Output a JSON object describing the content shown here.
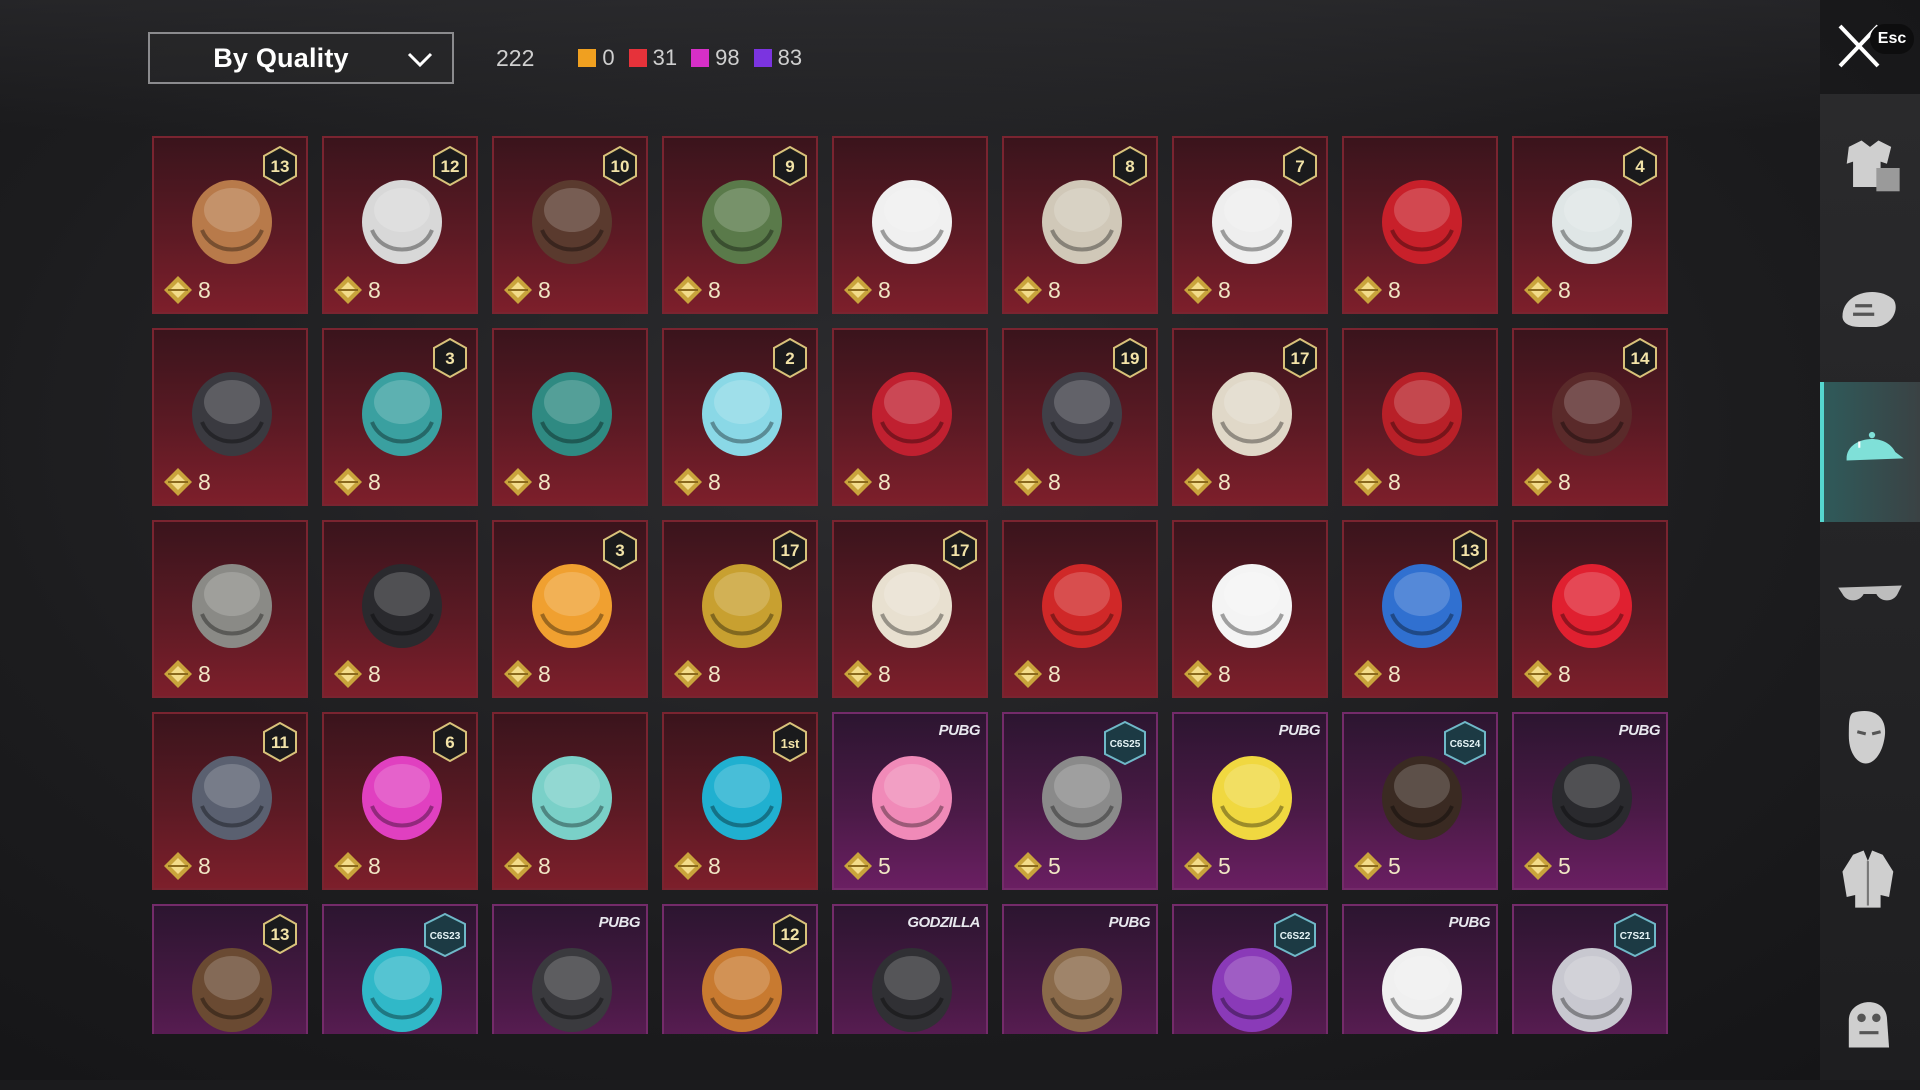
{
  "filter": {
    "label": "By Quality"
  },
  "total": "222",
  "quality_counts": [
    {
      "color": "#f0a020",
      "value": "0"
    },
    {
      "color": "#e6323a",
      "value": "31"
    },
    {
      "color": "#d62fc7",
      "value": "98"
    },
    {
      "color": "#7b34e0",
      "value": "83"
    }
  ],
  "close": {
    "esc_label": "Esc"
  },
  "sidebar": [
    {
      "icon": "outfit-icon"
    },
    {
      "icon": "mask-icon"
    },
    {
      "icon": "cap-icon",
      "active": true
    },
    {
      "icon": "glasses-icon"
    },
    {
      "icon": "face-icon"
    },
    {
      "icon": "jacket-icon"
    },
    {
      "icon": "emote-icon"
    }
  ],
  "items": [
    {
      "quality": "red",
      "badge": "13",
      "cost": "8",
      "icon": "feather-hat-wig-icon",
      "art": "#b87a4a"
    },
    {
      "quality": "red",
      "badge": "12",
      "cost": "8",
      "icon": "white-braided-wig-icon",
      "art": "#d8d8d8"
    },
    {
      "quality": "red",
      "badge": "10",
      "cost": "8",
      "icon": "brown-long-wig-icon",
      "art": "#5a3a2e"
    },
    {
      "quality": "red",
      "badge": "9",
      "cost": "8",
      "icon": "zombie-mask-icon",
      "art": "#5a7a4a"
    },
    {
      "quality": "red",
      "badge": "",
      "cost": "8",
      "icon": "white-cowboy-hat-icon",
      "art": "#f0f0f0"
    },
    {
      "quality": "red",
      "badge": "8",
      "cost": "8",
      "icon": "silver-winged-hair-icon",
      "art": "#d0c8b8"
    },
    {
      "quality": "red",
      "badge": "7",
      "cost": "8",
      "icon": "white-ponytail-hair-icon",
      "art": "#eeeeee"
    },
    {
      "quality": "red",
      "badge": "",
      "cost": "8",
      "icon": "red-helmet-icon",
      "art": "#c8202a"
    },
    {
      "quality": "red",
      "badge": "4",
      "cost": "8",
      "icon": "snowman-tophat-icon",
      "art": "#dfe6e6"
    },
    {
      "quality": "red",
      "badge": "",
      "cost": "8",
      "icon": "spider-helmet-icon",
      "art": "#3a3a40"
    },
    {
      "quality": "red",
      "badge": "3",
      "cost": "8",
      "icon": "joker-mask-icon",
      "art": "#3aa0a0"
    },
    {
      "quality": "red",
      "badge": "",
      "cost": "8",
      "icon": "teal-dragon-helm-icon",
      "art": "#2f8a82"
    },
    {
      "quality": "red",
      "badge": "2",
      "cost": "8",
      "icon": "ice-bucket-hat-icon",
      "art": "#8ad8e6"
    },
    {
      "quality": "red",
      "badge": "",
      "cost": "8",
      "icon": "red-oni-mask-icon",
      "art": "#c02030"
    },
    {
      "quality": "red",
      "badge": "19",
      "cost": "8",
      "icon": "dark-tactical-helmet-icon",
      "art": "#404048"
    },
    {
      "quality": "red",
      "badge": "17",
      "cost": "8",
      "icon": "white-spiky-hair-icon",
      "art": "#e0d8c8"
    },
    {
      "quality": "red",
      "badge": "",
      "cost": "8",
      "icon": "red-robot-helmet-icon",
      "art": "#b82028"
    },
    {
      "quality": "red",
      "badge": "14",
      "cost": "8",
      "icon": "golden-horn-hood-icon",
      "art": "#5a2a2a"
    },
    {
      "quality": "red",
      "badge": "",
      "cost": "8",
      "icon": "knight-helm-icon",
      "art": "#8a8a86"
    },
    {
      "quality": "red",
      "badge": "",
      "cost": "8",
      "icon": "black-bat-helm-icon",
      "art": "#2a2a2e"
    },
    {
      "quality": "red",
      "badge": "3",
      "cost": "8",
      "icon": "fries-hat-icon",
      "art": "#f0a030"
    },
    {
      "quality": "red",
      "badge": "17",
      "cost": "8",
      "icon": "gold-black-helmet-icon",
      "art": "#c8a030"
    },
    {
      "quality": "red",
      "badge": "17",
      "cost": "8",
      "icon": "white-gold-crown-icon",
      "art": "#e8e0d0"
    },
    {
      "quality": "red",
      "badge": "",
      "cost": "8",
      "icon": "panda-red-hair-icon",
      "art": "#d02828"
    },
    {
      "quality": "red",
      "badge": "",
      "cost": "8",
      "icon": "ghost-hood-icon",
      "art": "#f4f4f4"
    },
    {
      "quality": "red",
      "badge": "13",
      "cost": "8",
      "icon": "blue-mech-helmet-icon",
      "art": "#3070d0"
    },
    {
      "quality": "red",
      "badge": "",
      "cost": "8",
      "icon": "red-bow-clip-icon",
      "art": "#e02030"
    },
    {
      "quality": "red",
      "badge": "11",
      "cost": "8",
      "icon": "cyber-helmet-icon",
      "art": "#5a6070"
    },
    {
      "quality": "red",
      "badge": "6",
      "cost": "8",
      "icon": "pink-tv-head-icon",
      "art": "#e040c0"
    },
    {
      "quality": "red",
      "badge": "",
      "cost": "8",
      "icon": "butterfly-flower-icon",
      "art": "#7ad0c8"
    },
    {
      "quality": "red",
      "badge": "1st",
      "cost": "8",
      "icon": "neon-racer-helmet-icon",
      "art": "#20b0d0"
    },
    {
      "quality": "purple",
      "tag": "PUBG",
      "cost": "5",
      "icon": "pink-bow-headband-icon",
      "art": "#f08ab8"
    },
    {
      "quality": "purple",
      "hex": "C6S25",
      "cost": "5",
      "icon": "grey-bun-hair-icon",
      "art": "#8a8a8a"
    },
    {
      "quality": "purple",
      "tag": "PUBG",
      "cost": "5",
      "icon": "yellow-cube-mask-icon",
      "art": "#f0d840"
    },
    {
      "quality": "purple",
      "hex": "C6S24",
      "cost": "5",
      "icon": "brown-bob-hair-icon",
      "art": "#3a2a22"
    },
    {
      "quality": "purple",
      "tag": "PUBG",
      "cost": "5",
      "icon": "black-braids-hair-icon",
      "art": "#2a2a2e"
    },
    {
      "quality": "purple",
      "badge": "13",
      "cost": "",
      "icon": "aviator-goggles-cap-icon",
      "art": "#6a4a32"
    },
    {
      "quality": "purple",
      "hex": "C6S23",
      "cost": "",
      "icon": "cat-ear-headphones-icon",
      "art": "#30b8c8"
    },
    {
      "quality": "purple",
      "tag": "PUBG",
      "cost": "",
      "icon": "red-visor-cap-icon",
      "art": "#3a3a3e"
    },
    {
      "quality": "purple",
      "badge": "12",
      "cost": "",
      "icon": "orange-hood-icon",
      "art": "#c87a30"
    },
    {
      "quality": "purple",
      "tag": "GODZILLA",
      "cost": "",
      "icon": "godzilla-cap-icon",
      "art": "#303034"
    },
    {
      "quality": "purple",
      "tag": "PUBG",
      "cost": "",
      "icon": "bear-head-icon",
      "art": "#8a6a4a"
    },
    {
      "quality": "purple",
      "hex": "C6S22",
      "cost": "",
      "icon": "purple-teal-hair-icon",
      "art": "#8a3ab8"
    },
    {
      "quality": "purple",
      "tag": "PUBG",
      "cost": "",
      "icon": "panda-head-icon",
      "art": "#f0f0f0"
    },
    {
      "quality": "purple",
      "hex": "C7S21",
      "cost": "",
      "icon": "silver-swept-hair-icon",
      "art": "#c8c8d0"
    }
  ]
}
